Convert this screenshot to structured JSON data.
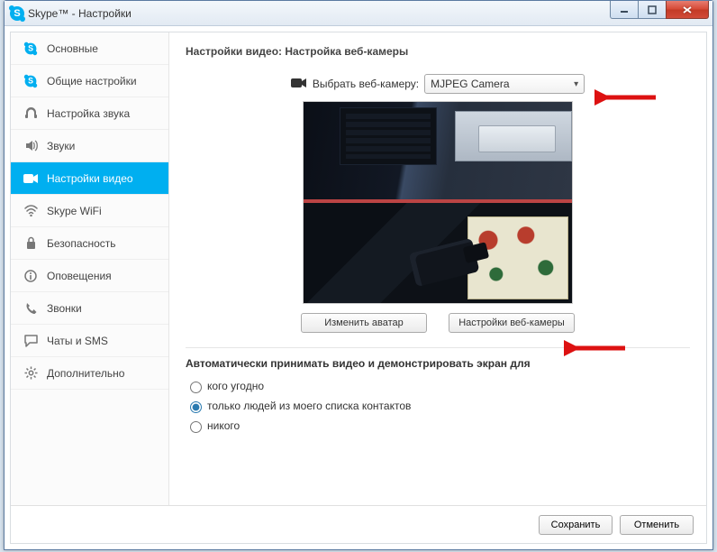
{
  "window": {
    "title": "Skype™ - Настройки"
  },
  "sidebar": {
    "items": [
      {
        "label": "Основные",
        "icon": "skype"
      },
      {
        "label": "Общие настройки",
        "icon": "skype"
      },
      {
        "label": "Настройка звука",
        "icon": "headset"
      },
      {
        "label": "Звуки",
        "icon": "speaker"
      },
      {
        "label": "Настройки видео",
        "icon": "camera",
        "active": true
      },
      {
        "label": "Skype WiFi",
        "icon": "wifi"
      },
      {
        "label": "Безопасность",
        "icon": "lock"
      },
      {
        "label": "Оповещения",
        "icon": "info"
      },
      {
        "label": "Звонки",
        "icon": "phone"
      },
      {
        "label": "Чаты и SMS",
        "icon": "chat"
      },
      {
        "label": "Дополнительно",
        "icon": "gear"
      }
    ]
  },
  "main": {
    "heading": "Настройки видео: Настройка веб-камеры",
    "selectLabel": "Выбрать веб-камеру:",
    "selectedCamera": "MJPEG Camera",
    "changeAvatar": "Изменить аватар",
    "camSettings": "Настройки веб-камеры",
    "autoTitle": "Автоматически принимать видео и демонстрировать экран для",
    "radios": [
      {
        "label": "кого угодно",
        "checked": false
      },
      {
        "label": "только людей из моего списка контактов",
        "checked": true
      },
      {
        "label": "никого",
        "checked": false
      }
    ]
  },
  "footer": {
    "save": "Сохранить",
    "cancel": "Отменить"
  }
}
